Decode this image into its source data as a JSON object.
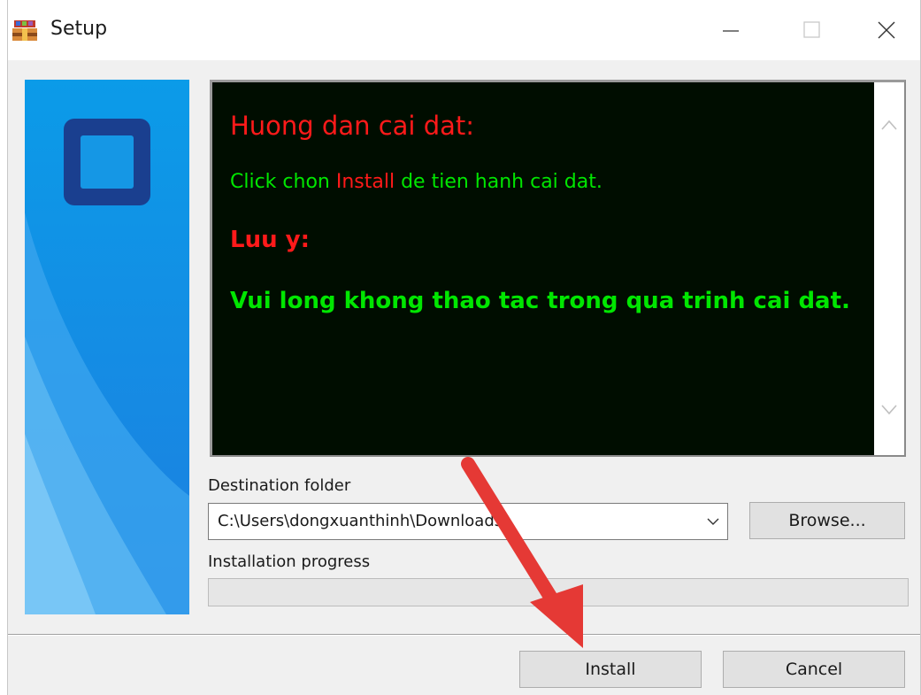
{
  "window": {
    "title": "Setup",
    "controls": {
      "minimize": "minimize",
      "maximize": "maximize",
      "close": "close"
    }
  },
  "readme": {
    "heading": "Huong dan cai dat:",
    "instruction_prefix": "Click chon ",
    "instruction_highlight": "Install",
    "instruction_suffix": " de tien hanh cai dat.",
    "note_heading": "Luu y:",
    "note_text": "Vui long khong thao tac trong qua trinh cai dat."
  },
  "destination": {
    "label": "Destination folder",
    "value": "C:\\Users\\dongxuanthinh\\Downloads"
  },
  "progress": {
    "label": "Installation progress",
    "value": 0
  },
  "buttons": {
    "browse": "Browse...",
    "install": "Install",
    "cancel": "Cancel"
  },
  "colors": {
    "readme_bg": "#000d00",
    "readme_green": "#00e600",
    "readme_red": "#ff1a1a",
    "banner_blue": "#1e88e5",
    "annotation_arrow": "#e53935"
  },
  "icons": [
    "winrar-setup-icon",
    "minimize-icon",
    "maximize-icon",
    "close-icon",
    "chevron-up-icon",
    "chevron-down-icon",
    "dropdown-arrow-icon"
  ]
}
